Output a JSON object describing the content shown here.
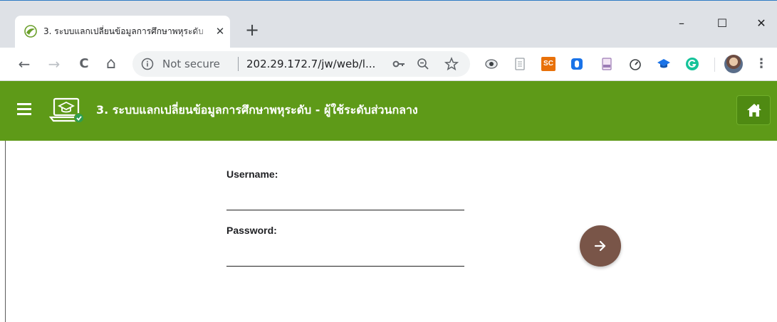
{
  "browser": {
    "tab": {
      "title": "3. ระบบแลกเปลี่ยนข้อมูลการศึกษาพหุระดับ",
      "close_glyph": "✕"
    },
    "new_tab_glyph": "+",
    "window_controls": {
      "minimize": "–",
      "maximize": "☐",
      "close": "✕"
    },
    "toolbar": {
      "back_glyph": "←",
      "forward_glyph": "→",
      "reload_glyph": "C",
      "home_glyph": "⌂",
      "security_label": "Not secure",
      "url": "202.29.172.7/jw/web/l...",
      "menu_glyph": "⋮"
    },
    "extensions": [
      "hidden-eye-icon",
      "document-icon",
      "sc-icon",
      "blue-badge-icon",
      "pdf-icon",
      "speedometer-icon",
      "grad-cap-icon",
      "grammarly-icon"
    ],
    "extension_labels": {
      "sc": "SC"
    }
  },
  "app": {
    "title": "3. ระบบแลกเปลี่ยนข้อมูลการศึกษาพหุระดับ - ผู้ใช้ระดับส่วนกลาง",
    "colors": {
      "header": "#5e9a18",
      "submit": "#795548"
    }
  },
  "login": {
    "username_label": "Username:",
    "username_value": "",
    "password_label": "Password:",
    "password_value": ""
  }
}
